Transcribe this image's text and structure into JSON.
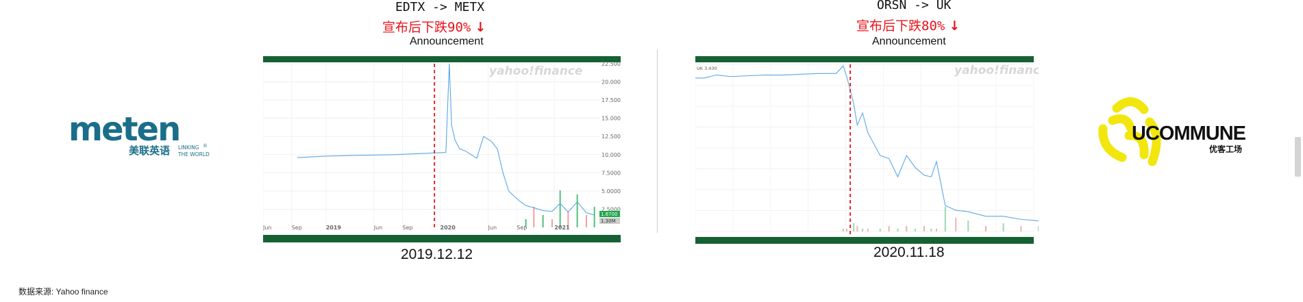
{
  "logos": {
    "left": {
      "wordmark": "meten",
      "chinese": "美联英语",
      "tagline_1": "LINKING",
      "tagline_2": "THE WORLD",
      "reg": "®"
    },
    "right": {
      "wordmark": "UCOMMUNE",
      "chinese": "优客工场"
    }
  },
  "panels": [
    {
      "ticker": "EDTX -> METX",
      "drop": "宣布后下跌90%",
      "arrow": "↓",
      "announcement": "Announcement",
      "date": "2019.12.12",
      "watermark": "yahoo!finance"
    },
    {
      "ticker": "ORSN -> UK",
      "drop": "宣布后下跌80%",
      "arrow": "↓",
      "announcement": "Announcement",
      "date": "2020.11.18",
      "watermark": "yahoo!finance"
    }
  ],
  "source_note": "数据来源: Yahoo finance",
  "colors": {
    "accent_bar": "#166134",
    "drop_text": "#e8131b",
    "price_line": "#5aa7e6",
    "announce_line": "#e8131b",
    "meten_blue": "#1b6e8a",
    "meten_green": "#55a532",
    "ucommune_yellow": "#f2e60f"
  },
  "chart_data": [
    {
      "type": "line",
      "ticker": "EDTX -> METX",
      "x_ticks": [
        "Jun",
        "Sep",
        "2019",
        "Jun",
        "Sep",
        "2020",
        "Jun",
        "Sep",
        "2021"
      ],
      "y_ticks": [
        "22.5000",
        "20.0000",
        "17.5000",
        "15.0000",
        "12.5000",
        "10.0000",
        "7.5000",
        "5.0000",
        "2.5000"
      ],
      "ylim": [
        0,
        22.5
      ],
      "current_price_label": "1.6700",
      "volume_label": "1.30M",
      "announcement_x": 2019.95,
      "series": [
        {
          "x": [
            2018.75,
            2019.0,
            2019.3,
            2019.6,
            2019.9,
            2020.05,
            2020.08,
            2020.1,
            2020.13,
            2020.17,
            2020.22,
            2020.32,
            2020.38,
            2020.45,
            2020.5,
            2020.55,
            2020.6,
            2020.68,
            2020.75,
            2020.82,
            2020.9,
            2020.98,
            2021.05,
            2021.12,
            2021.2,
            2021.28,
            2021.35
          ],
          "values": [
            9.6,
            9.8,
            9.9,
            10.0,
            10.2,
            10.3,
            22.5,
            14.0,
            12.0,
            10.8,
            10.5,
            9.5,
            12.5,
            11.8,
            10.8,
            7.5,
            5.0,
            3.8,
            3.0,
            2.7,
            2.3,
            2.2,
            3.3,
            2.1,
            3.5,
            2.0,
            1.7
          ]
        }
      ],
      "volume": [
        0,
        0,
        0,
        0,
        0,
        0,
        0,
        0,
        0,
        0,
        0,
        0,
        0,
        0,
        0,
        0,
        0,
        0,
        0.2,
        0.5,
        0.3,
        0.2,
        0.9,
        0.4,
        0.8,
        0.3,
        0.5
      ]
    },
    {
      "type": "line",
      "ticker": "ORSN -> UK",
      "price_label": "UK 3.430",
      "announcement_x": 2020.88,
      "ylim": [
        0,
        11
      ],
      "series": [
        {
          "x": [
            2020.0,
            2020.05,
            2020.12,
            2020.2,
            2020.3,
            2020.4,
            2020.5,
            2020.6,
            2020.7,
            2020.8,
            2020.84,
            2020.86,
            2020.9,
            2020.92,
            2020.95,
            2020.98,
            2021.05,
            2021.1,
            2021.15,
            2021.2,
            2021.25,
            2021.3,
            2021.34,
            2021.37,
            2021.42,
            2021.48,
            2021.55,
            2021.65,
            2021.75,
            2021.85,
            2021.95
          ],
          "values": [
            10.1,
            10.1,
            10.3,
            10.2,
            10.25,
            10.3,
            10.3,
            10.35,
            10.4,
            10.4,
            10.9,
            10.2,
            8.4,
            7.0,
            7.8,
            6.5,
            5.0,
            4.8,
            3.6,
            5.0,
            4.2,
            3.7,
            3.6,
            4.6,
            1.7,
            1.4,
            1.3,
            1.0,
            1.0,
            0.8,
            0.7
          ]
        }
      ],
      "volume": [
        0,
        0,
        0,
        0,
        0,
        0,
        0,
        0,
        0,
        0,
        0.1,
        0.1,
        0.3,
        0.2,
        0.1,
        0.1,
        0.1,
        0.2,
        0.1,
        0.2,
        0.1,
        0.2,
        0.1,
        0.1,
        0.9,
        0.5,
        0.4,
        0.2,
        0.3,
        0.2,
        0.2
      ]
    }
  ]
}
